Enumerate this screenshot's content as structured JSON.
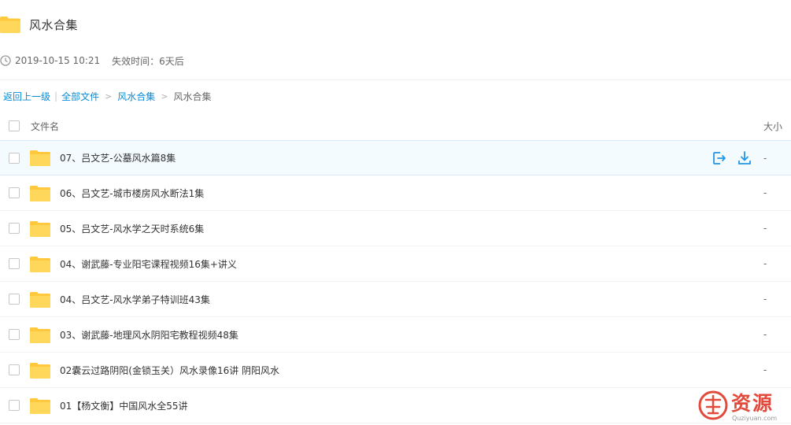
{
  "header": {
    "title": "风水合集"
  },
  "meta": {
    "datetime": "2019-10-15 10:21",
    "expiry": "失效时间：6天后"
  },
  "breadcrumb": {
    "back": "返回上一级",
    "sep": "|",
    "all_files": "全部文件",
    "gt1": ">",
    "parent": "风水合集",
    "gt2": ">",
    "current": "风水合集"
  },
  "list_header": {
    "name": "文件名",
    "size": "大小"
  },
  "files": [
    {
      "name": "07、吕文艺-公墓风水篇8集",
      "size": "-"
    },
    {
      "name": "06、吕文艺-城市楼房风水断法1集",
      "size": "-"
    },
    {
      "name": "05、吕文艺-风水学之天时系统6集",
      "size": "-"
    },
    {
      "name": "04、谢武藤-专业阳宅课程视频16集+讲义",
      "size": "-"
    },
    {
      "name": "04、吕文艺-风水学弟子特训班43集",
      "size": "-"
    },
    {
      "name": "03、谢武藤-地理风水阴阳宅教程视频48集",
      "size": "-"
    },
    {
      "name": "02囊云过路阴阳(金锁玉关）风水录像16讲 阴阳风水",
      "size": "-"
    },
    {
      "name": "01【杨文衡】中国风水全55讲",
      "size": "-"
    }
  ],
  "watermark": {
    "text": "资源",
    "sub": "Quziyuan.com"
  },
  "colors": {
    "link": "#0a8bd6",
    "folder": "#ffd24d",
    "accent": "#2296e8",
    "watermark": "#e24a3b"
  },
  "icons": [
    "folder-icon",
    "clock-icon",
    "save-to-icon",
    "download-icon",
    "checkbox"
  ]
}
